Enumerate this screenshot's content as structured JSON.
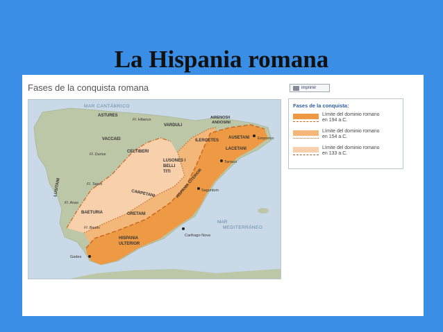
{
  "slide": {
    "title": "La Hispania romana"
  },
  "map": {
    "title": "Fases de la conquista romana",
    "print_label": "imprimir",
    "labels": {
      "mar_cantabrico": "MAR CANTÁBRICO",
      "astures": "ASTURES",
      "fl_hiberus": "Fl. Hiberus",
      "vardulli": "VARDULI",
      "aireno": "AIRENOSII",
      "andosini": "ANDOSINI",
      "vaccaei": "VACCAEI",
      "ilergetes": "ILERGETES",
      "ausetani": "AUSETANI",
      "lacetani": "LACETANI",
      "emporion": "Emporion",
      "fl_durius": "Fl. Durius",
      "celtiberi": "CELTIBERI",
      "tarraco": "Tarraco",
      "lusones": "LUSONES I",
      "belli": "BELLI",
      "titi": "TITI",
      "lusitani": "LUSITANI",
      "fl_tagus": "Fl. Tagus",
      "carpetani": "CARPETANI",
      "hispania_citerior": "HISPANIA CITERIOR",
      "saguntum": "Saguntum",
      "fl_anas": "Fl. Anas",
      "baeturia": "BAETURIA",
      "oretani": "ORETANI",
      "mar": "MAR",
      "mediterraneo": "MEDITERRÁNEO",
      "fl_baetis": "Fl. Baetis",
      "hispania": "HISPANIA",
      "ulterior": "ULTERIOR",
      "carthago_nova": "Carthago Nova",
      "gades": "Gades"
    }
  },
  "legend": {
    "title": "Fases de la conquista:",
    "items": [
      {
        "line1": "Límite del dominio romano",
        "line2": "en 194 a.C.",
        "color": "#ee9a45",
        "line_style": "dashed"
      },
      {
        "line1": "Límite del dominio romano",
        "line2": "en 154 a.C.",
        "color": "#f4b77a",
        "line_style": "dotted"
      },
      {
        "line1": "Límite del dominio romano",
        "line2": "en 133 a.C.",
        "color": "#f8d1ac",
        "line_style": "dashdot"
      }
    ]
  },
  "colors": {
    "background": "#3a8ee6",
    "sea": "#c9d9e7",
    "land": "#bcc7a7",
    "zone_194": "#ee9a45",
    "zone_154": "#f4b77a",
    "zone_133": "#f8d1ac",
    "boundary": "#c8641e"
  }
}
